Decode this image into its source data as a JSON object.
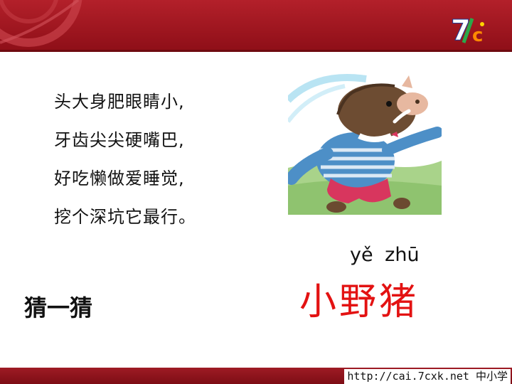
{
  "logo": {
    "text": "7cx"
  },
  "riddle": {
    "lines": [
      "头大身肥眼睛小,",
      "牙齿尖尖硬嘴巴,",
      "好吃懒做爱睡觉,",
      "挖个深坑它最行。"
    ]
  },
  "picture": {
    "icon": "wild-boar-cartoon"
  },
  "answer": {
    "pinyin": "yě zhū",
    "text": "小野猪"
  },
  "prompt": {
    "text": "猜一猜"
  },
  "footer": {
    "url": "http://cai.7cxk.net 中小学"
  },
  "colors": {
    "header": "#a0161f",
    "answer": "#e31212",
    "footer": "#8a1019"
  }
}
